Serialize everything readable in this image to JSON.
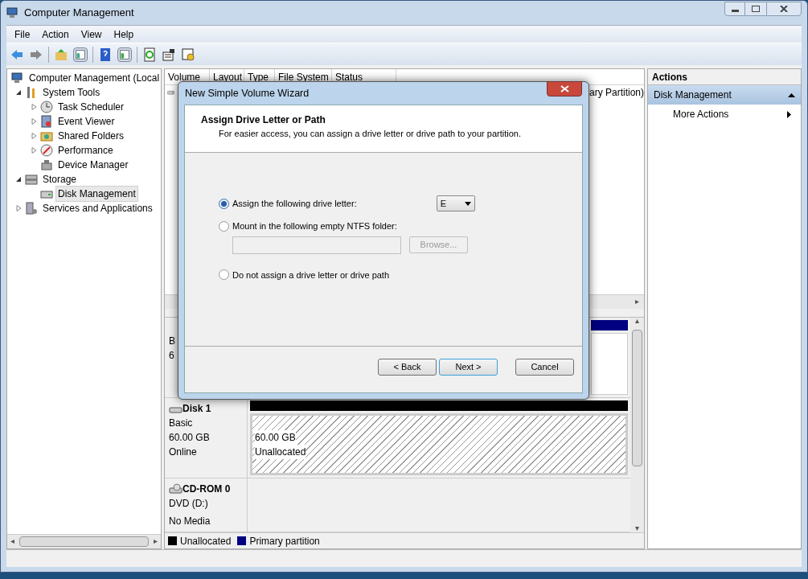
{
  "window": {
    "title": "Computer Management"
  },
  "menu": [
    "File",
    "Action",
    "View",
    "Help"
  ],
  "tree": [
    {
      "label": "Computer Management (Local",
      "selected": false,
      "children": [
        {
          "label": "System Tools",
          "expanded": true,
          "selected": false,
          "children": [
            {
              "label": "Task Scheduler",
              "expanded": false,
              "selected": false
            },
            {
              "label": "Event Viewer",
              "expanded": false,
              "selected": false
            },
            {
              "label": "Shared Folders",
              "expanded": false,
              "selected": false
            },
            {
              "label": "Performance",
              "expanded": false,
              "selected": false
            },
            {
              "label": "Device Manager",
              "selected": false
            }
          ]
        },
        {
          "label": "Storage",
          "expanded": true,
          "selected": false,
          "children": [
            {
              "label": "Disk Management",
              "selected": true
            }
          ]
        },
        {
          "label": "Services and Applications",
          "expanded": false,
          "selected": false
        }
      ]
    }
  ],
  "volume_table": {
    "columns": [
      "Volume",
      "Layout",
      "Type",
      "File System",
      "Status"
    ],
    "rows": [
      {
        "column_5": "ary Partition)"
      }
    ]
  },
  "disks": [
    {
      "lines": [
        "B",
        "6"
      ],
      "partitions": [
        {
          "kind": "primary",
          "color": "#000080"
        }
      ]
    },
    {
      "name": "Disk 1",
      "lines": [
        "Basic",
        "60.00 GB",
        "Online"
      ],
      "partitions": [
        {
          "kind": "unallocated",
          "color": "#000000",
          "size": "60.00 GB",
          "status": "Unallocated"
        }
      ]
    },
    {
      "name": "CD-ROM 0",
      "lines": [
        "DVD (D:)"
      ],
      "status": "No Media"
    }
  ],
  "legend": [
    {
      "label": "Unallocated",
      "color": "#000000"
    },
    {
      "label": "Primary partition",
      "color": "#000080"
    }
  ],
  "actions": {
    "title": "Actions",
    "sections": [
      {
        "label": "Disk Management",
        "expanded": true,
        "items": [
          "More Actions"
        ]
      }
    ]
  },
  "dialog": {
    "title": "New Simple Volume Wizard",
    "heading": "Assign Drive Letter or Path",
    "subtitle": "For easier access, you can assign a drive letter or drive path to your partition.",
    "options": [
      {
        "kind": "letter",
        "label": "Assign the following drive letter:",
        "selected": true,
        "value": "E"
      },
      {
        "kind": "folder",
        "label": "Mount in the following empty NTFS folder:",
        "selected": false,
        "button": "Browse..."
      },
      {
        "kind": "none",
        "label": "Do not assign a drive letter or drive path",
        "selected": false
      }
    ],
    "buttons": [
      {
        "label": "< Back",
        "default": false
      },
      {
        "label": "Next >",
        "default": true
      },
      {
        "label": "Cancel",
        "default": false
      }
    ]
  }
}
